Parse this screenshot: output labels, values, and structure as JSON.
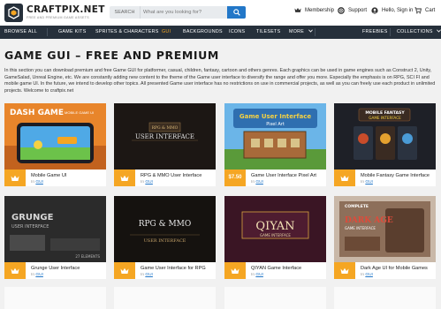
{
  "header": {
    "logo_name": "CRAFTPIX.NET",
    "logo_tagline": "FREE AND PREMIUM GAME ASSETS",
    "search": {
      "scope": "SEARCH",
      "placeholder": "What are you looking for?"
    },
    "membership": "Membership",
    "support": "Support",
    "account": "Hello, Sign in",
    "cart": "Cart"
  },
  "nav": {
    "items": [
      "BROWSE ALL",
      "GAME KITS",
      "SPRITES & CHARACTERS",
      "GUI",
      "BACKGROUNDS",
      "ICONS",
      "TILESETS",
      "MORE"
    ],
    "right": [
      "FREEBIES",
      "COLLECTIONS"
    ],
    "active": "GUI"
  },
  "page": {
    "title": "GAME GUI – FREE AND PREMIUM",
    "intro": "In this section you can download premium and free Game GUI for platformer, casual, children, fantasy, cartoon and others genres. Each graphics can be used in game engines such as Construct 2, Unity, GameSalad, Unreal Engine, etc. We are constantly adding new content to the theme of the Game user interface to diversify the range and offer you more. Especially the emphasis is on RPG, SCI FI and mobile game UI. In the future, we intend to develop other topics. All presented Game user interface has no restrictions on use in commercial projects, as well as you can freely use each product in unlimited projects. Welcome to craftpix.net"
  },
  "products": [
    {
      "title": "Mobile Game UI",
      "in": "In",
      "category": "GUI",
      "badge": "crown",
      "thumb_text": [
        "DASH GAME",
        "MOBILE GAME UI"
      ]
    },
    {
      "title": "RPG & MMO User Interface",
      "in": "In",
      "category": "GUI",
      "badge": "crown",
      "thumb_text": [
        "RPG & MMO",
        "USER INTERFACE"
      ]
    },
    {
      "title": "Game User Interface Pixel Art",
      "in": "In",
      "category": "GUI",
      "badge": "$7.50",
      "thumb_text": [
        "Game User Interface",
        "Pixel Art"
      ]
    },
    {
      "title": "Mobile Fantasy Game Interface",
      "in": "In",
      "category": "GUI",
      "badge": "crown",
      "thumb_text": [
        "MOBILE FANTASY",
        "GAME INTERFACE"
      ]
    },
    {
      "title": "Grunge User Interface",
      "in": "In",
      "category": "GUI",
      "badge": "crown",
      "thumb_text": [
        "GRUNGE",
        "USER INTERFACE",
        "27 ELEMENTS"
      ]
    },
    {
      "title": "Game User Interface for RPG",
      "in": "In",
      "category": "GUI",
      "badge": "crown",
      "thumb_text": [
        "RPG & MMO",
        "USER INTERFACE"
      ]
    },
    {
      "title": "QIYAN Game Interface",
      "in": "In",
      "category": "GUI",
      "badge": "crown",
      "thumb_text": [
        "QIYAN",
        "GAME INTERFACE"
      ]
    },
    {
      "title": "Dark Age UI for Mobile Games",
      "in": "In",
      "category": "GUI",
      "badge": "crown",
      "thumb_text": [
        "COMPLETE",
        "DARK AGE",
        "GAME INTERFACE"
      ]
    }
  ],
  "icons": {
    "search_button": "search-icon",
    "membership": "crown-icon",
    "support": "lifebuoy-icon",
    "account": "user-icon",
    "cart": "cart-icon",
    "more": "chevron-down-icon",
    "collections": "chevron-down-icon",
    "product_badge": "crown-icon"
  },
  "colors": {
    "accent": "#f5a623",
    "link": "#2277c8",
    "nav": "#26303b",
    "search_button": "#2277c8"
  }
}
